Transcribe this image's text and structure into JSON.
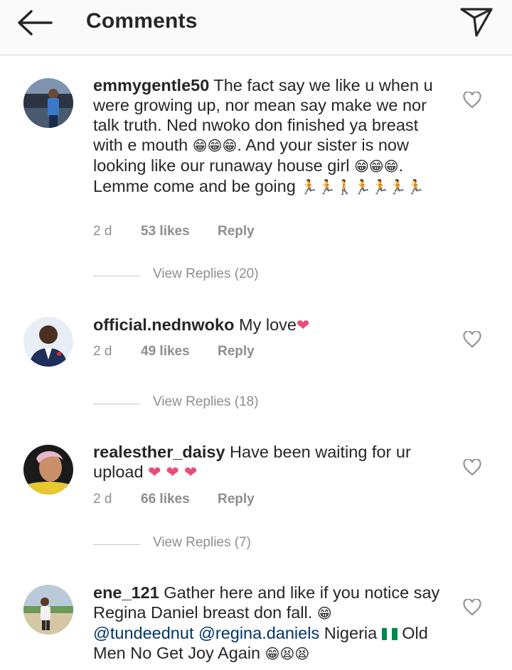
{
  "header": {
    "title": "Comments",
    "back_icon": "arrow-left-icon",
    "send_icon": "paper-plane-icon"
  },
  "comments": [
    {
      "username": "emmygentle50",
      "text_1": " The fact say we like u when u were growing up, nor mean say make we nor talk truth. Ned nwoko don finished ya breast with e mouth ",
      "emoji_1": "😁😁😁",
      "text_2": ". And your sister is now looking like our runaway house girl ",
      "emoji_2": "😁😁😁",
      "text_3": ". Lemme come and be going ",
      "emoji_3": "🏃🏃🚶🏃🏃🏃🏃",
      "time": "2 d",
      "likes": "53 likes",
      "reply": "Reply",
      "view_replies": "View Replies (20)"
    },
    {
      "username": "official.nednwoko",
      "text_1": " My love",
      "emoji_1": "❤",
      "time": "2 d",
      "likes": "49 likes",
      "reply": "Reply",
      "view_replies": "View Replies (18)"
    },
    {
      "username": "realesther_daisy",
      "text_1": " Have been waiting for ur upload ",
      "emoji_1": "❤ ❤ ❤",
      "time": "2 d",
      "likes": "66 likes",
      "reply": "Reply",
      "view_replies": "View Replies (7)"
    },
    {
      "username": "ene_121",
      "text_1": " Gather here and like if you notice say Regina Daniel breast don fall. ",
      "emoji_1": "😁",
      "mention_1": "@tundeednut",
      "mention_2": "@regina.daniels",
      "text_2": " Nigeria ",
      "text_3": " Old Men No Get Joy Again ",
      "emoji_2": "😁😫😫"
    }
  ],
  "colors": {
    "heart": "#e84c78",
    "muted": "#8e8e8e",
    "mention": "#003569",
    "flag_green": "#008751"
  }
}
